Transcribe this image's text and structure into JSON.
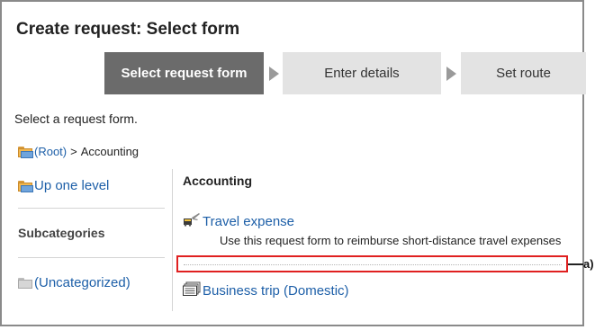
{
  "page_title": "Create request: Select form",
  "steps": [
    {
      "label": "Select request form",
      "state": "active"
    },
    {
      "label": "Enter details",
      "state": "inactive"
    },
    {
      "label": "Set route",
      "state": "inactive"
    }
  ],
  "instruction": "Select a request form.",
  "breadcrumb": {
    "root": "(Root)",
    "separator": ">",
    "current": "Accounting"
  },
  "sidebar": {
    "up_one_level": "Up one level",
    "subcategories_heading": "Subcategories",
    "uncategorized": "(Uncategorized)"
  },
  "category": {
    "title": "Accounting",
    "forms": [
      {
        "name": "Travel expense",
        "description": "Use this request form to reimburse short-distance travel expenses",
        "icon": "travel-icon"
      },
      {
        "name": "Business trip (Domestic)",
        "description": "",
        "icon": "form-stack-icon"
      }
    ]
  },
  "annotation": {
    "label": "a)",
    "color": "#e02020"
  },
  "colors": {
    "link": "#1d5fa8",
    "active_step": "#6b6b6b",
    "inactive_step": "#e3e3e3"
  }
}
